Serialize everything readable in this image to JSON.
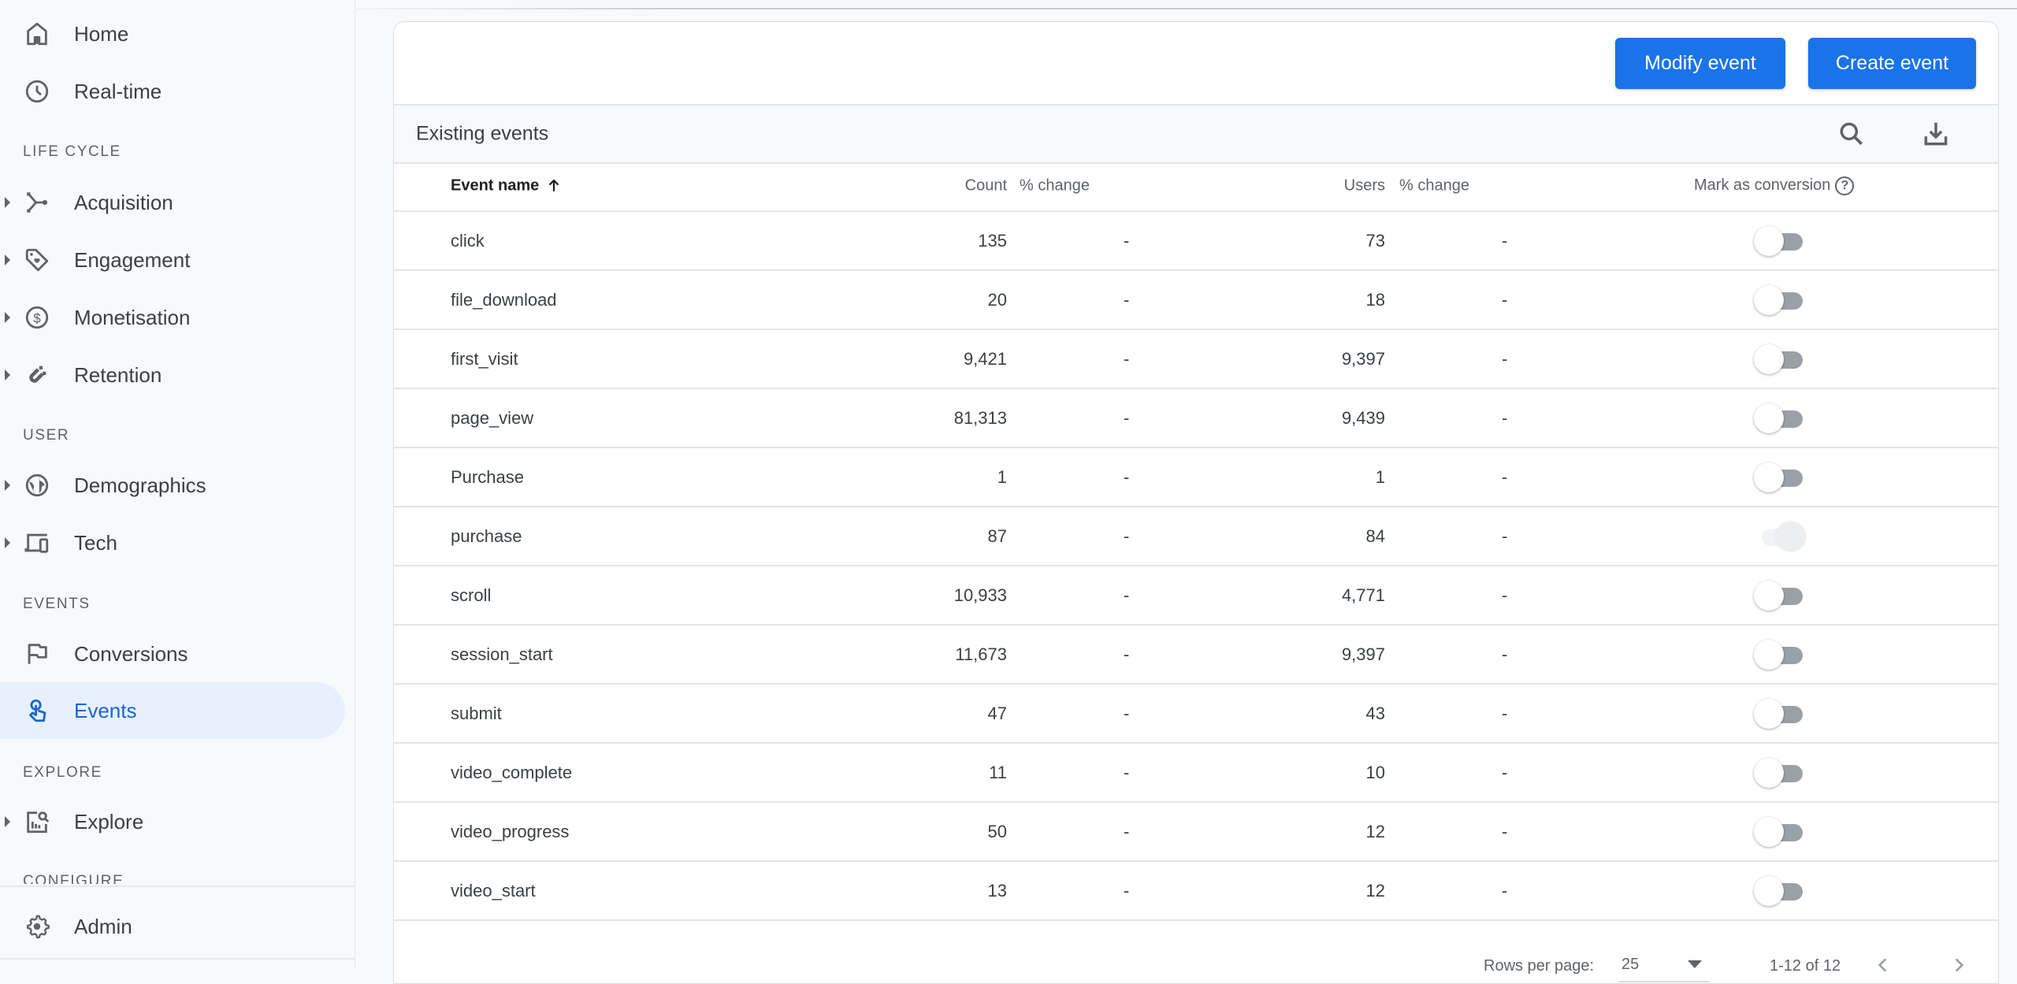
{
  "sidebar": {
    "items": {
      "home": {
        "label": "Home",
        "icon": "home-icon"
      },
      "realtime": {
        "label": "Real-time",
        "icon": "clock-icon"
      },
      "acquisition": {
        "label": "Acquisition",
        "icon": "acquisition-icon"
      },
      "engagement": {
        "label": "Engagement",
        "icon": "tag-heart-icon"
      },
      "monetisation": {
        "label": "Monetisation",
        "icon": "dollar-circle-icon"
      },
      "retention": {
        "label": "Retention",
        "icon": "magnet-icon"
      },
      "demographics": {
        "label": "Demographics",
        "icon": "globe-icon"
      },
      "tech": {
        "label": "Tech",
        "icon": "devices-icon"
      },
      "conversions": {
        "label": "Conversions",
        "icon": "flag-icon"
      },
      "events": {
        "label": "Events",
        "icon": "touch-icon",
        "active": true
      },
      "explore": {
        "label": "Explore",
        "icon": "explore-chart-icon"
      },
      "admin": {
        "label": "Admin",
        "icon": "gear-icon"
      }
    },
    "sections": {
      "lifecycle": "LIFE CYCLE",
      "user": "USER",
      "events": "EVENTS",
      "explore": "EXPLORE",
      "configure": "CONFIGURE"
    }
  },
  "toolbar": {
    "modify_label": "Modify event",
    "create_label": "Create event"
  },
  "table": {
    "title": "Existing events",
    "columns": {
      "event_name": "Event name",
      "count": "Count",
      "count_change": "% change",
      "users": "Users",
      "users_change": "% change",
      "conversion": "Mark as conversion",
      "help": "?"
    },
    "sort": {
      "column": "event_name",
      "direction": "ascending"
    },
    "rows": [
      {
        "name": "click",
        "count": "135",
        "count_change": "-",
        "users": "73",
        "users_change": "-",
        "conversion": false,
        "disabled": false
      },
      {
        "name": "file_download",
        "count": "20",
        "count_change": "-",
        "users": "18",
        "users_change": "-",
        "conversion": false,
        "disabled": false
      },
      {
        "name": "first_visit",
        "count": "9,421",
        "count_change": "-",
        "users": "9,397",
        "users_change": "-",
        "conversion": false,
        "disabled": false
      },
      {
        "name": "page_view",
        "count": "81,313",
        "count_change": "-",
        "users": "9,439",
        "users_change": "-",
        "conversion": false,
        "disabled": false
      },
      {
        "name": "Purchase",
        "count": "1",
        "count_change": "-",
        "users": "1",
        "users_change": "-",
        "conversion": false,
        "disabled": false
      },
      {
        "name": "purchase",
        "count": "87",
        "count_change": "-",
        "users": "84",
        "users_change": "-",
        "conversion": true,
        "disabled": true
      },
      {
        "name": "scroll",
        "count": "10,933",
        "count_change": "-",
        "users": "4,771",
        "users_change": "-",
        "conversion": false,
        "disabled": false
      },
      {
        "name": "session_start",
        "count": "11,673",
        "count_change": "-",
        "users": "9,397",
        "users_change": "-",
        "conversion": false,
        "disabled": false
      },
      {
        "name": "submit",
        "count": "47",
        "count_change": "-",
        "users": "43",
        "users_change": "-",
        "conversion": false,
        "disabled": false
      },
      {
        "name": "video_complete",
        "count": "11",
        "count_change": "-",
        "users": "10",
        "users_change": "-",
        "conversion": false,
        "disabled": false
      },
      {
        "name": "video_progress",
        "count": "50",
        "count_change": "-",
        "users": "12",
        "users_change": "-",
        "conversion": false,
        "disabled": false
      },
      {
        "name": "video_start",
        "count": "13",
        "count_change": "-",
        "users": "12",
        "users_change": "-",
        "conversion": false,
        "disabled": false
      }
    ]
  },
  "pagination": {
    "rows_per_page_label": "Rows per page:",
    "rows_per_page": "25",
    "range": "1-12 of 12"
  },
  "colors": {
    "accent": "#1a73e8",
    "active_nav_bg": "#e8f0fe",
    "active_nav_text": "#1967d2"
  }
}
